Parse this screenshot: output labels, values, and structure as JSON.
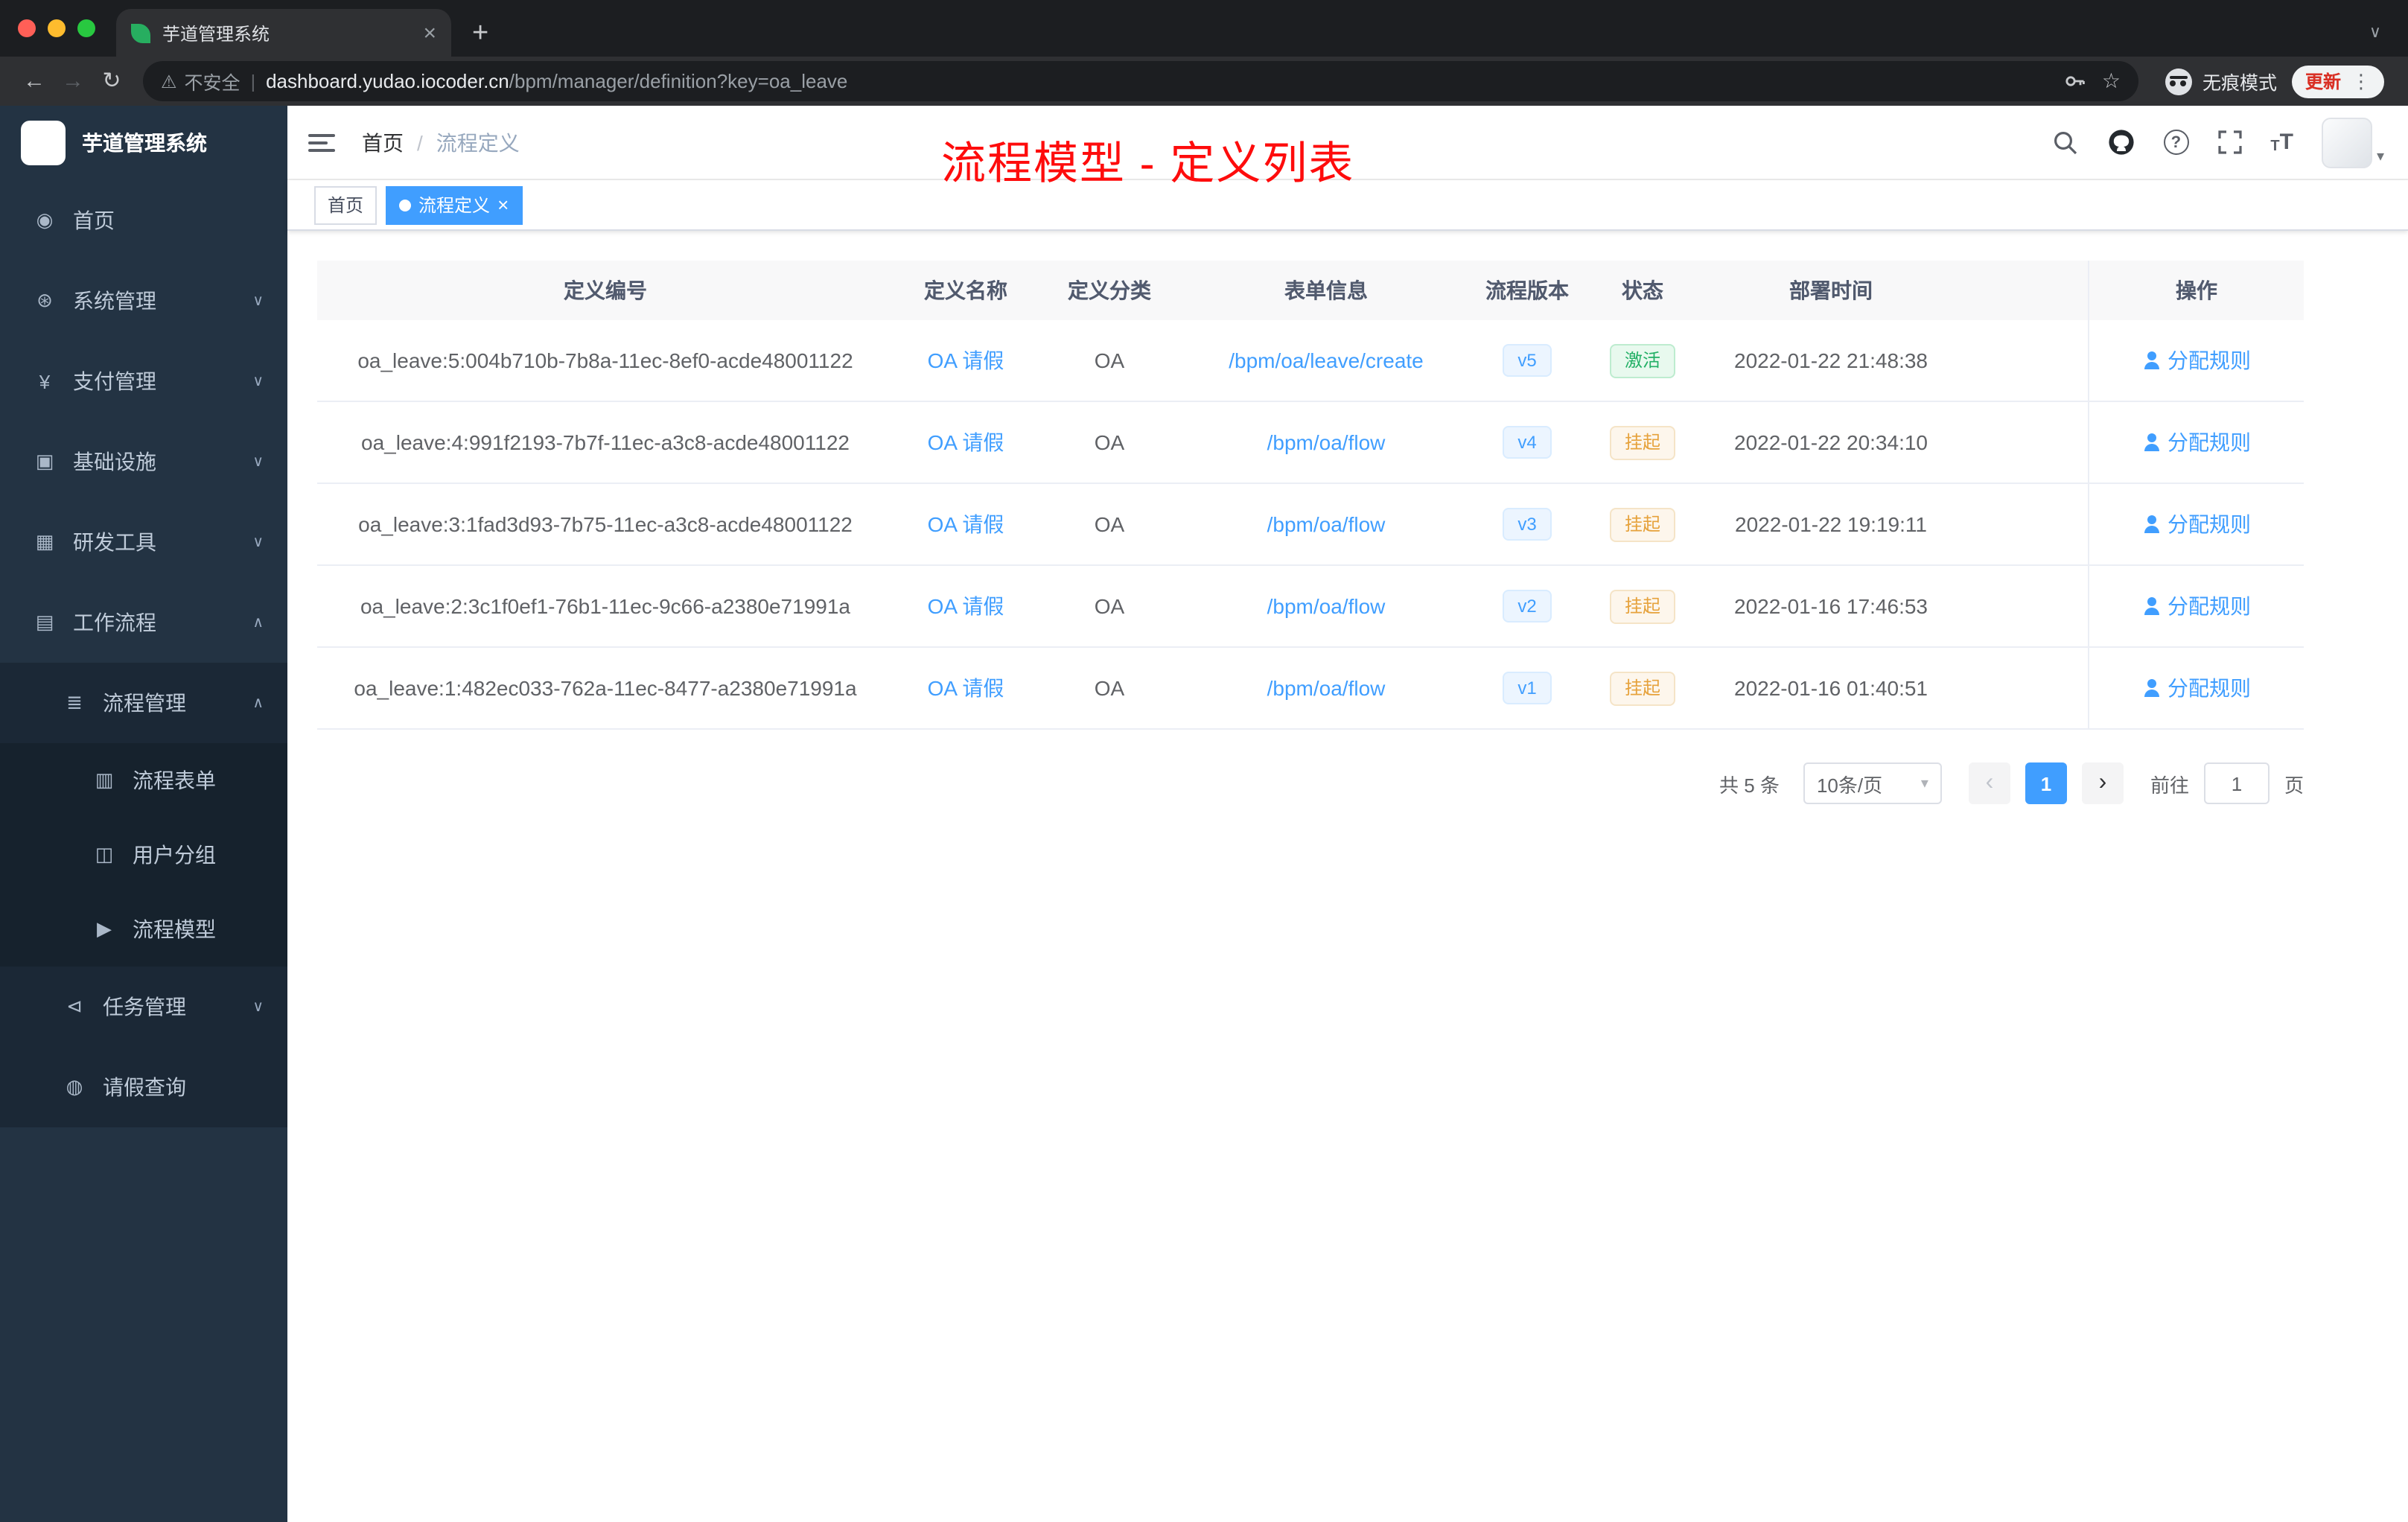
{
  "browser": {
    "tab_title": "芋道管理系统",
    "security_label": "不安全",
    "url_domain": "dashboard.yudao.iocoder.cn",
    "url_path": "/bpm/manager/definition?key=oa_leave",
    "incognito_label": "无痕模式",
    "update_label": "更新"
  },
  "sidebar": {
    "logo_title": "芋道管理系统",
    "menu": [
      {
        "key": "home",
        "icon": "dashboard-icon",
        "label": "首页",
        "depth": 0
      },
      {
        "key": "system-management",
        "icon": "gear-icon",
        "label": "系统管理",
        "depth": 0,
        "chevron": "down"
      },
      {
        "key": "payment-management",
        "icon": "yen-icon",
        "label": "支付管理",
        "depth": 0,
        "chevron": "down"
      },
      {
        "key": "infrastructure",
        "icon": "monitor-icon",
        "label": "基础设施",
        "depth": 0,
        "chevron": "down"
      },
      {
        "key": "dev-tools",
        "icon": "toolbox-icon",
        "label": "研发工具",
        "depth": 0,
        "chevron": "down"
      },
      {
        "key": "workflow",
        "icon": "briefcase-icon",
        "label": "工作流程",
        "depth": 0,
        "chevron": "up"
      },
      {
        "key": "process-management",
        "icon": "list-icon",
        "label": "流程管理",
        "depth": 1,
        "chevron": "up"
      },
      {
        "key": "process-form",
        "icon": "document-icon",
        "label": "流程表单",
        "depth": 2
      },
      {
        "key": "user-group",
        "icon": "usergroup-icon",
        "label": "用户分组",
        "depth": 2
      },
      {
        "key": "process-model",
        "icon": "paper-plane-icon",
        "label": "流程模型",
        "depth": 2
      },
      {
        "key": "task-management",
        "icon": "flag-icon",
        "label": "任务管理",
        "depth": 1,
        "chevron": "down"
      },
      {
        "key": "leave-query",
        "icon": "user-icon",
        "label": "请假查询",
        "depth": 1
      }
    ]
  },
  "header": {
    "breadcrumb": [
      "首页",
      "流程定义"
    ],
    "annotation": "流程模型 - 定义列表"
  },
  "tags": [
    {
      "label": "首页",
      "active": false
    },
    {
      "label": "流程定义",
      "active": true
    }
  ],
  "table": {
    "columns": [
      {
        "key": "id",
        "label": "定义编号"
      },
      {
        "key": "name",
        "label": "定义名称"
      },
      {
        "key": "category",
        "label": "定义分类"
      },
      {
        "key": "form",
        "label": "表单信息"
      },
      {
        "key": "version",
        "label": "流程版本"
      },
      {
        "key": "status",
        "label": "状态"
      },
      {
        "key": "deploy_time",
        "label": "部署时间"
      },
      {
        "key": "action",
        "label": "操作"
      }
    ],
    "rows": [
      {
        "id": "oa_leave:5:004b710b-7b8a-11ec-8ef0-acde48001122",
        "name": "OA 请假",
        "category": "OA",
        "form": "/bpm/oa/leave/create",
        "version": "v5",
        "status": "激活",
        "status_type": "success",
        "deploy_time": "2022-01-22 21:48:38",
        "action": "分配规则"
      },
      {
        "id": "oa_leave:4:991f2193-7b7f-11ec-a3c8-acde48001122",
        "name": "OA 请假",
        "category": "OA",
        "form": "/bpm/oa/flow",
        "version": "v4",
        "status": "挂起",
        "status_type": "warning",
        "deploy_time": "2022-01-22 20:34:10",
        "action": "分配规则"
      },
      {
        "id": "oa_leave:3:1fad3d93-7b75-11ec-a3c8-acde48001122",
        "name": "OA 请假",
        "category": "OA",
        "form": "/bpm/oa/flow",
        "version": "v3",
        "status": "挂起",
        "status_type": "warning",
        "deploy_time": "2022-01-22 19:19:11",
        "action": "分配规则"
      },
      {
        "id": "oa_leave:2:3c1f0ef1-76b1-11ec-9c66-a2380e71991a",
        "name": "OA 请假",
        "category": "OA",
        "form": "/bpm/oa/flow",
        "version": "v2",
        "status": "挂起",
        "status_type": "warning",
        "deploy_time": "2022-01-16 17:46:53",
        "action": "分配规则"
      },
      {
        "id": "oa_leave:1:482ec033-762a-11ec-8477-a2380e71991a",
        "name": "OA 请假",
        "category": "OA",
        "form": "/bpm/oa/flow",
        "version": "v1",
        "status": "挂起",
        "status_type": "warning",
        "deploy_time": "2022-01-16 01:40:51",
        "action": "分配规则"
      }
    ]
  },
  "pagination": {
    "total_text": "共 5 条",
    "page_size": "10条/页",
    "current_page": "1",
    "goto_label": "前往",
    "goto_value": "1",
    "page_suffix": "页"
  },
  "colors": {
    "accent": "#409eff",
    "success": "#23b066",
    "warning": "#e6a23c",
    "annotation_red": "#fe0c0c",
    "sidebar_bg": "#233343"
  }
}
